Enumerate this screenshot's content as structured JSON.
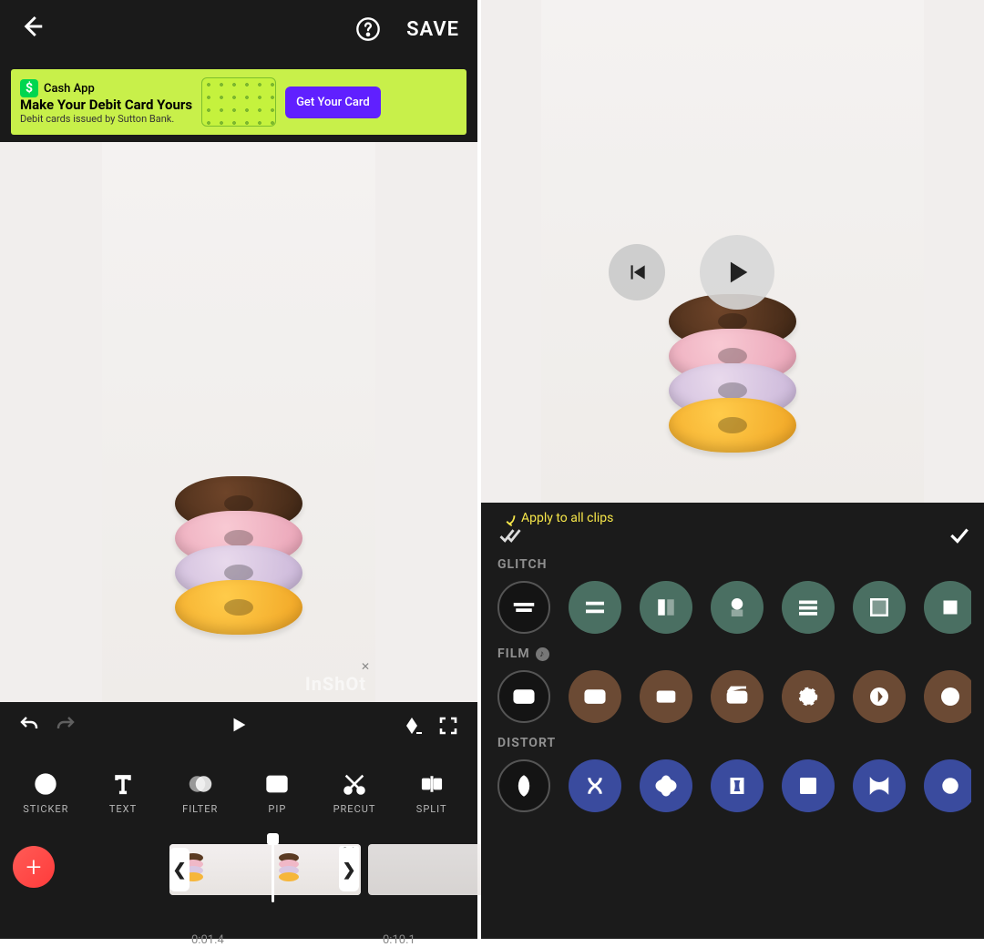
{
  "topbar": {
    "save": "SAVE"
  },
  "ad": {
    "brand": "Cash App",
    "headline": "Make Your Debit Card Yours",
    "sub": "Debit cards issued by Sutton Bank.",
    "cta": "Get Your Card"
  },
  "watermark": "InShOt",
  "tools": [
    {
      "id": "sticker",
      "label": "STICKER"
    },
    {
      "id": "text",
      "label": "TEXT"
    },
    {
      "id": "filter",
      "label": "FILTER"
    },
    {
      "id": "pip",
      "label": "PIP"
    },
    {
      "id": "precut",
      "label": "PRECUT"
    },
    {
      "id": "split",
      "label": "SPLIT"
    }
  ],
  "timeline": {
    "speed_badge": "2.1",
    "time_a": "0:01.4",
    "time_b": "0:10.1"
  },
  "tip": "Apply to all clips",
  "fx": {
    "categories": [
      {
        "id": "glitch",
        "title": "GLITCH",
        "music": false,
        "count": 7,
        "color": "#4a6f62"
      },
      {
        "id": "film",
        "title": "FILM",
        "music": true,
        "count": 7,
        "color": "#6b4a34"
      },
      {
        "id": "distort",
        "title": "DISTORT",
        "music": false,
        "count": 7,
        "color": "#3a4b9e"
      }
    ]
  }
}
